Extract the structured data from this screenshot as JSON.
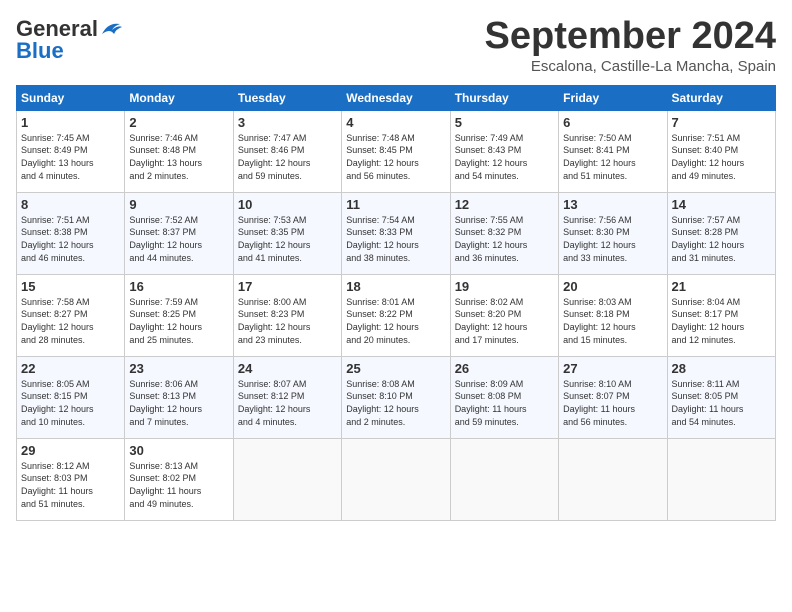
{
  "header": {
    "logo_general": "General",
    "logo_blue": "Blue",
    "month_title": "September 2024",
    "location": "Escalona, Castille-La Mancha, Spain"
  },
  "weekdays": [
    "Sunday",
    "Monday",
    "Tuesday",
    "Wednesday",
    "Thursday",
    "Friday",
    "Saturday"
  ],
  "weeks": [
    [
      {
        "day": "1",
        "lines": [
          "Sunrise: 7:45 AM",
          "Sunset: 8:49 PM",
          "Daylight: 13 hours",
          "and 4 minutes."
        ]
      },
      {
        "day": "2",
        "lines": [
          "Sunrise: 7:46 AM",
          "Sunset: 8:48 PM",
          "Daylight: 13 hours",
          "and 2 minutes."
        ]
      },
      {
        "day": "3",
        "lines": [
          "Sunrise: 7:47 AM",
          "Sunset: 8:46 PM",
          "Daylight: 12 hours",
          "and 59 minutes."
        ]
      },
      {
        "day": "4",
        "lines": [
          "Sunrise: 7:48 AM",
          "Sunset: 8:45 PM",
          "Daylight: 12 hours",
          "and 56 minutes."
        ]
      },
      {
        "day": "5",
        "lines": [
          "Sunrise: 7:49 AM",
          "Sunset: 8:43 PM",
          "Daylight: 12 hours",
          "and 54 minutes."
        ]
      },
      {
        "day": "6",
        "lines": [
          "Sunrise: 7:50 AM",
          "Sunset: 8:41 PM",
          "Daylight: 12 hours",
          "and 51 minutes."
        ]
      },
      {
        "day": "7",
        "lines": [
          "Sunrise: 7:51 AM",
          "Sunset: 8:40 PM",
          "Daylight: 12 hours",
          "and 49 minutes."
        ]
      }
    ],
    [
      {
        "day": "8",
        "lines": [
          "Sunrise: 7:51 AM",
          "Sunset: 8:38 PM",
          "Daylight: 12 hours",
          "and 46 minutes."
        ]
      },
      {
        "day": "9",
        "lines": [
          "Sunrise: 7:52 AM",
          "Sunset: 8:37 PM",
          "Daylight: 12 hours",
          "and 44 minutes."
        ]
      },
      {
        "day": "10",
        "lines": [
          "Sunrise: 7:53 AM",
          "Sunset: 8:35 PM",
          "Daylight: 12 hours",
          "and 41 minutes."
        ]
      },
      {
        "day": "11",
        "lines": [
          "Sunrise: 7:54 AM",
          "Sunset: 8:33 PM",
          "Daylight: 12 hours",
          "and 38 minutes."
        ]
      },
      {
        "day": "12",
        "lines": [
          "Sunrise: 7:55 AM",
          "Sunset: 8:32 PM",
          "Daylight: 12 hours",
          "and 36 minutes."
        ]
      },
      {
        "day": "13",
        "lines": [
          "Sunrise: 7:56 AM",
          "Sunset: 8:30 PM",
          "Daylight: 12 hours",
          "and 33 minutes."
        ]
      },
      {
        "day": "14",
        "lines": [
          "Sunrise: 7:57 AM",
          "Sunset: 8:28 PM",
          "Daylight: 12 hours",
          "and 31 minutes."
        ]
      }
    ],
    [
      {
        "day": "15",
        "lines": [
          "Sunrise: 7:58 AM",
          "Sunset: 8:27 PM",
          "Daylight: 12 hours",
          "and 28 minutes."
        ]
      },
      {
        "day": "16",
        "lines": [
          "Sunrise: 7:59 AM",
          "Sunset: 8:25 PM",
          "Daylight: 12 hours",
          "and 25 minutes."
        ]
      },
      {
        "day": "17",
        "lines": [
          "Sunrise: 8:00 AM",
          "Sunset: 8:23 PM",
          "Daylight: 12 hours",
          "and 23 minutes."
        ]
      },
      {
        "day": "18",
        "lines": [
          "Sunrise: 8:01 AM",
          "Sunset: 8:22 PM",
          "Daylight: 12 hours",
          "and 20 minutes."
        ]
      },
      {
        "day": "19",
        "lines": [
          "Sunrise: 8:02 AM",
          "Sunset: 8:20 PM",
          "Daylight: 12 hours",
          "and 17 minutes."
        ]
      },
      {
        "day": "20",
        "lines": [
          "Sunrise: 8:03 AM",
          "Sunset: 8:18 PM",
          "Daylight: 12 hours",
          "and 15 minutes."
        ]
      },
      {
        "day": "21",
        "lines": [
          "Sunrise: 8:04 AM",
          "Sunset: 8:17 PM",
          "Daylight: 12 hours",
          "and 12 minutes."
        ]
      }
    ],
    [
      {
        "day": "22",
        "lines": [
          "Sunrise: 8:05 AM",
          "Sunset: 8:15 PM",
          "Daylight: 12 hours",
          "and 10 minutes."
        ]
      },
      {
        "day": "23",
        "lines": [
          "Sunrise: 8:06 AM",
          "Sunset: 8:13 PM",
          "Daylight: 12 hours",
          "and 7 minutes."
        ]
      },
      {
        "day": "24",
        "lines": [
          "Sunrise: 8:07 AM",
          "Sunset: 8:12 PM",
          "Daylight: 12 hours",
          "and 4 minutes."
        ]
      },
      {
        "day": "25",
        "lines": [
          "Sunrise: 8:08 AM",
          "Sunset: 8:10 PM",
          "Daylight: 12 hours",
          "and 2 minutes."
        ]
      },
      {
        "day": "26",
        "lines": [
          "Sunrise: 8:09 AM",
          "Sunset: 8:08 PM",
          "Daylight: 11 hours",
          "and 59 minutes."
        ]
      },
      {
        "day": "27",
        "lines": [
          "Sunrise: 8:10 AM",
          "Sunset: 8:07 PM",
          "Daylight: 11 hours",
          "and 56 minutes."
        ]
      },
      {
        "day": "28",
        "lines": [
          "Sunrise: 8:11 AM",
          "Sunset: 8:05 PM",
          "Daylight: 11 hours",
          "and 54 minutes."
        ]
      }
    ],
    [
      {
        "day": "29",
        "lines": [
          "Sunrise: 8:12 AM",
          "Sunset: 8:03 PM",
          "Daylight: 11 hours",
          "and 51 minutes."
        ]
      },
      {
        "day": "30",
        "lines": [
          "Sunrise: 8:13 AM",
          "Sunset: 8:02 PM",
          "Daylight: 11 hours",
          "and 49 minutes."
        ]
      },
      null,
      null,
      null,
      null,
      null
    ]
  ]
}
